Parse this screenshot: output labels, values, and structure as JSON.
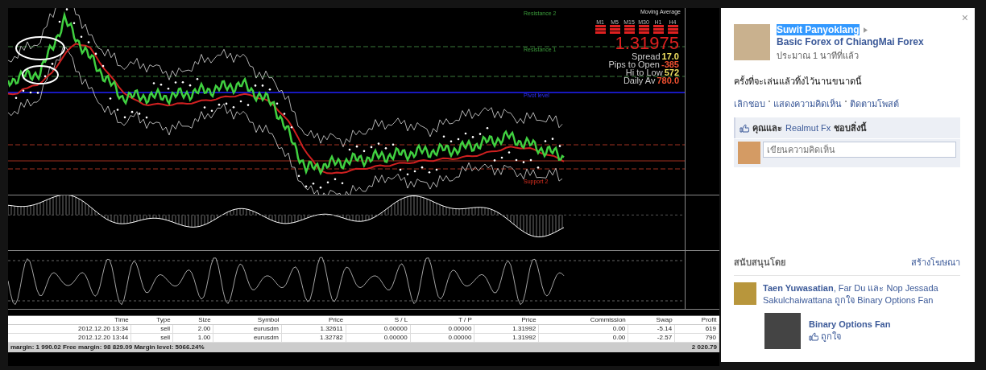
{
  "photo": {
    "chart": {
      "indicator_label": "Moving Average",
      "levels": [
        {
          "label": "Resistance 2",
          "kind": "resistance"
        },
        {
          "label": "Resistance 1",
          "kind": "resistance"
        },
        {
          "label": "Pivot level",
          "kind": "pivot"
        },
        {
          "label": "Support 2",
          "kind": "support"
        }
      ],
      "timeframes": [
        "M1",
        "M5",
        "M15",
        "M30",
        "H1",
        "H4"
      ],
      "price": "1.31975",
      "stats": [
        {
          "label": "Spread",
          "value": "17.0",
          "color": "#f0e060"
        },
        {
          "label": "Pips to Open",
          "value": "-385",
          "color": "#f05030"
        },
        {
          "label": "Hi to Low",
          "value": "572",
          "color": "#f0e060"
        },
        {
          "label": "Daily Av",
          "value": "780.0",
          "color": "#f05030"
        }
      ]
    },
    "table": {
      "columns": [
        "Time",
        "Type",
        "Size",
        "Symbol",
        "Price",
        "S / L",
        "T / P",
        "Price",
        "Commission",
        "Swap",
        "Profit"
      ],
      "rows": [
        [
          "2012.12.20 13:34",
          "sell",
          "2.00",
          "eurusdm",
          "1.32611",
          "0.00000",
          "0.00000",
          "1.31992",
          "0.00",
          "-5.14",
          "619"
        ],
        [
          "2012.12.20 13:44",
          "sell",
          "1.00",
          "eurusdm",
          "1.32782",
          "0.00000",
          "0.00000",
          "1.31992",
          "0.00",
          "-2.57",
          "790"
        ]
      ],
      "footer": "margin: 1 990.02  Free margin: 98 829.09  Margin level: 5066.24%",
      "footer_total": "2 020.79"
    }
  },
  "panel": {
    "close": "×",
    "author": "Suwit Panyoklang",
    "author_text_selected": true,
    "target": "Basic Forex of ChiangMai Forex",
    "time": "ประมาณ 1 นาทีที่แล้ว",
    "caption": "ครั้งที่จะเล่นแล้วทิ้งไว้นานขนาดนี้",
    "actions": [
      "เลิกชอบ",
      "แสดงความคิดเห็น",
      "ติดตามโพสต์"
    ],
    "likes": {
      "before": "คุณและ",
      "link": "Realmut Fx",
      "after": "ชอบสิ่งนี้"
    },
    "comment": {
      "placeholder": "เขียนความคิดเห็น"
    },
    "sponsored": {
      "title": "สนับสนุนโดย",
      "create_ad": "สร้างโฆษณา",
      "social": "**Taen Yuwasatian**, Far Du และ Nop Jessada Sakulchaiwattana ถูกใจ Binary Options Fan",
      "page": "Binary Options Fan",
      "like": "ถูกใจ"
    }
  }
}
